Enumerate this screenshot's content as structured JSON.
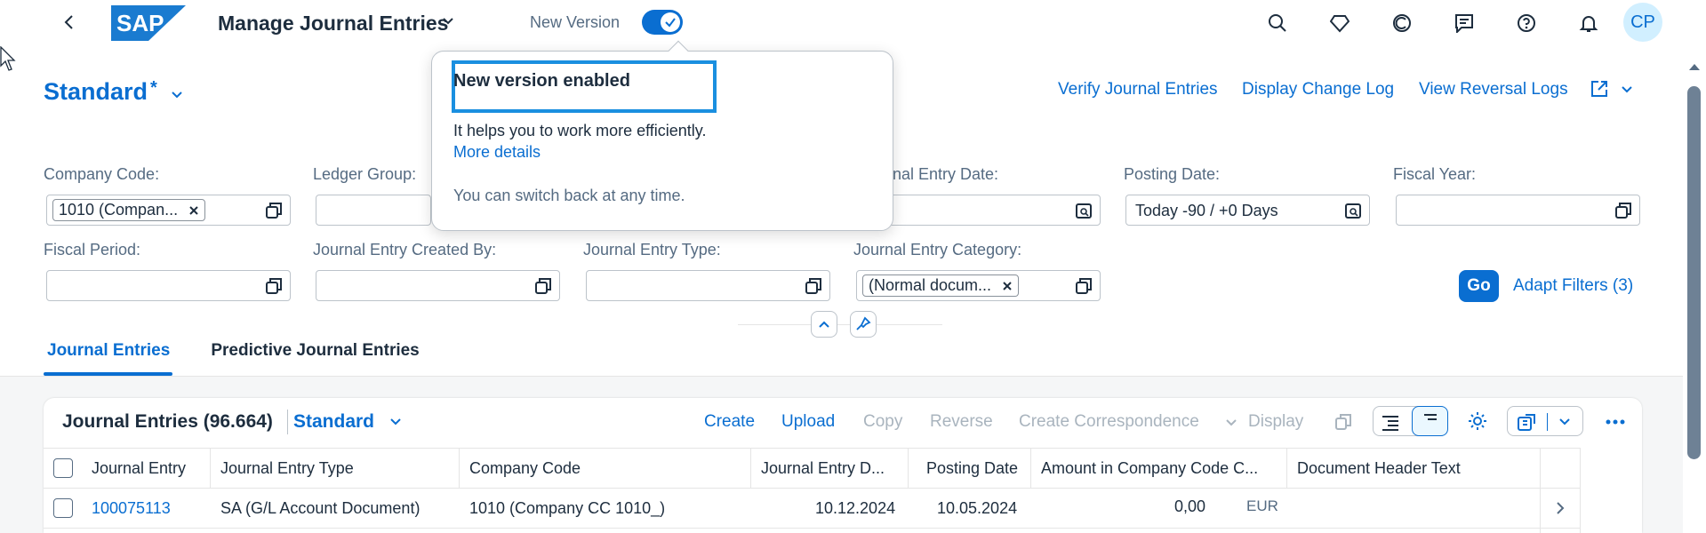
{
  "shell": {
    "title": "Manage Journal Entries",
    "new_version_label": "New Version",
    "avatar_initials": "CP",
    "brand": "SAP"
  },
  "header": {
    "variant": "Standard",
    "dirty_marker": "*",
    "actions": [
      "Verify Journal Entries",
      "Display Change Log",
      "View Reversal Logs"
    ]
  },
  "popover": {
    "title": "New version enabled",
    "text": "It helps you to work more efficiently.",
    "link": "More details",
    "note": "You can switch back at any time."
  },
  "filters": {
    "company_code": {
      "label": "Company Code:",
      "token": "1010 (Compan..."
    },
    "ledger_group": {
      "label": "Ledger Group:"
    },
    "journal_entry_date": {
      "label": "nal Entry Date:"
    },
    "posting_date": {
      "label": "Posting Date:",
      "value": "Today -90 / +0 Days"
    },
    "fiscal_year": {
      "label": "Fiscal Year:"
    },
    "fiscal_period": {
      "label": "Fiscal Period:"
    },
    "created_by": {
      "label": "Journal Entry Created By:"
    },
    "entry_type": {
      "label": "Journal Entry Type:"
    },
    "entry_category": {
      "label": "Journal Entry Category:",
      "token": "(Normal docum..."
    },
    "go": "Go",
    "adapt": "Adapt Filters (3)"
  },
  "tabs": [
    "Journal Entries",
    "Predictive Journal Entries"
  ],
  "table": {
    "title": "Journal Entries (96.664)",
    "variant": "Standard",
    "actions": {
      "create": "Create",
      "upload": "Upload",
      "copy": "Copy",
      "reverse": "Reverse",
      "correspondence": "Create Correspondence",
      "display": "Display"
    },
    "columns": [
      "Journal Entry",
      "Journal Entry Type",
      "Company Code",
      "Journal Entry D...",
      "Posting Date",
      "Amount in Company Code C...",
      "Document Header Text"
    ],
    "rows": [
      {
        "entry": "100075113",
        "type": "SA (G/L Account Document)",
        "company": "1010 (Company CC 1010_)",
        "entry_date": "10.12.2024",
        "posting_date": "10.05.2024",
        "amount": "0,00",
        "currency": "EUR",
        "header_text": ""
      }
    ]
  },
  "colors": {
    "accent": "#0a6ed1",
    "text": "#1d2d3e",
    "muted": "#556b82",
    "disabled": "#a9b4be"
  }
}
